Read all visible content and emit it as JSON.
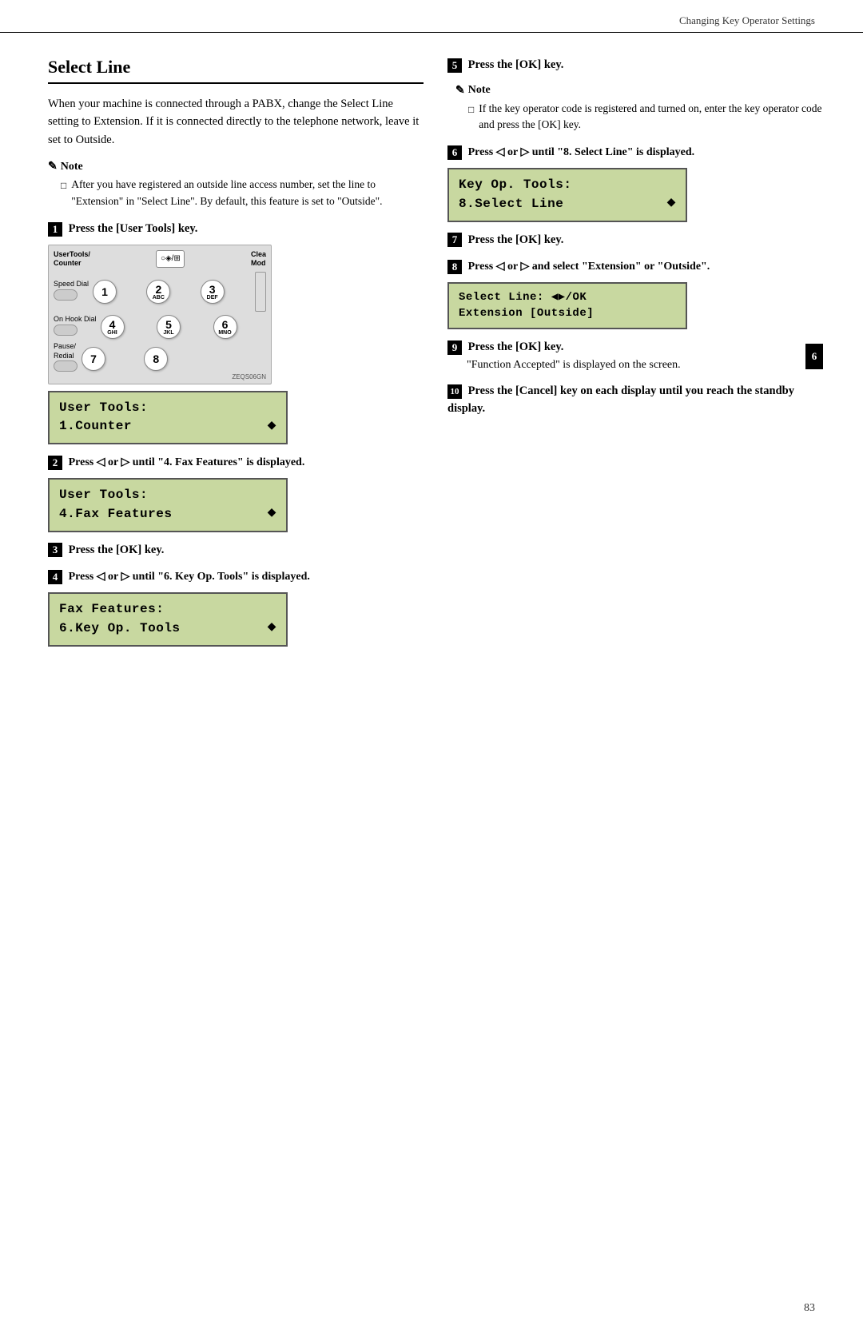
{
  "header": {
    "title": "Changing Key Operator Settings"
  },
  "section": {
    "title": "Select Line",
    "intro": "When your machine is connected through a PABX, change the Select Line setting to Extension. If it is connected directly to the telephone network, leave it set to Outside."
  },
  "note1": {
    "title": "Note",
    "item": "After you have registered an outside line access number, set the line to \"Extension\" in \"Select Line\". By default, this feature is set to \"Outside\"."
  },
  "steps": {
    "s1_label": "Press the",
    "s1_key": "[User Tools]",
    "s1_key2": "key.",
    "lcd1_line1": "User Tools:",
    "lcd1_line2": "1.Counter",
    "s2_label": "Press",
    "s2_body": " ◁ or ▷ until \"4. Fax Features\" is displayed.",
    "lcd2_line1": "User Tools:",
    "lcd2_line2": "4.Fax Features",
    "s3_label": "Press the",
    "s3_key": "[OK]",
    "s3_key2": "key.",
    "s4_label": "Press",
    "s4_body": " ◁ or ▷ until \"6. Key Op. Tools\" is displayed.",
    "lcd3_line1": "Fax Features:",
    "lcd3_line2": "6.Key Op. Tools",
    "s5_label": "Press the",
    "s5_key": "[OK]",
    "s5_key2": "key.",
    "note2_title": "Note",
    "note2_item": "If the key operator code is registered and turned on, enter the key operator code and press the [OK] key.",
    "s6_label": "Press",
    "s6_body": " ◁ or ▷ until \"8. Select Line\" is displayed.",
    "lcd4_line1": "Key Op. Tools:",
    "lcd4_line2": "8.Select Line",
    "s7_label": "Press the",
    "s7_key": "[OK]",
    "s7_key2": "key.",
    "s8_label": "Press",
    "s8_body": " ◁ or ▷ and select \"Extension\" or \"Outside\".",
    "lcd5_line1": "Select Line:    ◀▶/OK",
    "lcd5_line2": "Extension [Outside]",
    "s9_label": "Press the",
    "s9_key": "[OK]",
    "s9_key2": "key.",
    "s9_body": "\"Function Accepted\" is displayed on the screen.",
    "s10_label": "Press the",
    "s10_key": "[Cancel]",
    "s10_body": "key on each display until you reach the standby display."
  },
  "page_number": "83",
  "tab_label": "6",
  "zeqs_label": "ZEQS06GN"
}
